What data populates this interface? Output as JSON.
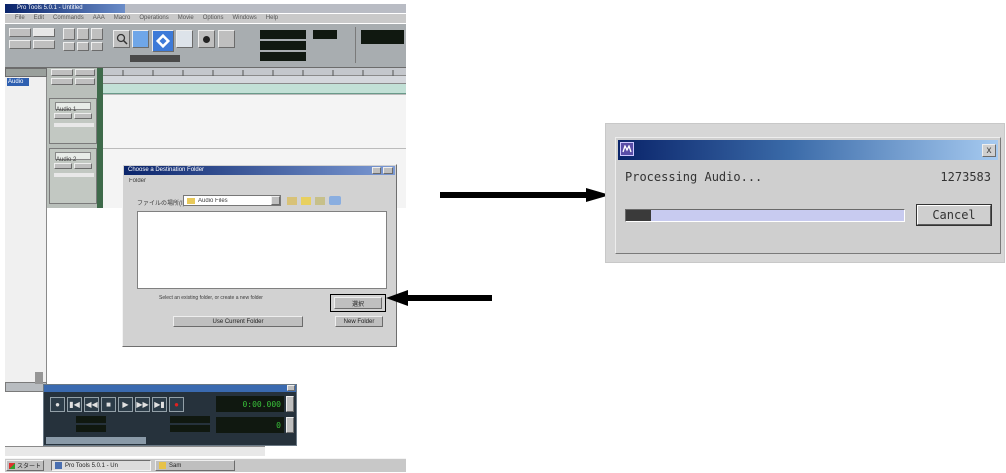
{
  "left_screenshot": {
    "app_title": "Pro Tools 5.0.1 - Untitled",
    "menu": [
      "File",
      "Edit",
      "Commands",
      "AAA",
      "Macro",
      "Operations",
      "Movie",
      "Options",
      "Windows",
      "Help"
    ],
    "track_list_label": "Audio",
    "tracks": [
      {
        "name": "Audio 1",
        "buttons": [
          "rec",
          "mute"
        ]
      },
      {
        "name": "Audio 2",
        "buttons": [
          "rec",
          "mute"
        ]
      }
    ],
    "dialog": {
      "title": "Choose a Destination Folder",
      "subtitle": "Folder",
      "location_label": "ファイルの場所(I):",
      "location_value": "Audio Files",
      "hint_text": "Select an existing folder, or create a new folder",
      "select_label": "選択",
      "new_folder_label": "New Folder",
      "current_folder_label": "Use Current Folder"
    },
    "transport": {
      "main_counter": "0:00.000",
      "sub_counter": "0",
      "buttons": [
        "online-icon",
        "return-to-zero-icon",
        "rewind-icon",
        "stop-icon",
        "play-icon",
        "fast-forward-icon",
        "go-to-end-icon",
        "record-icon"
      ]
    },
    "taskbar": {
      "start_label": "スタート",
      "task_label": "Pro Tools 5.0.1 - Un",
      "task2_label": "Sam"
    }
  },
  "progress_dialog": {
    "app_icon": "pro-tools-icon",
    "close_glyph": "x",
    "message": "Processing Audio...",
    "sample_count": "1273583",
    "progress_fraction": 0.09,
    "cancel_label": "Cancel"
  },
  "colors": {
    "title_bar_start": "#0a246a",
    "title_bar_end": "#a6caf0",
    "progress_fill": "#3a3a3a",
    "progress_track": "#c8cbf0",
    "lcd_green": "#39c13a",
    "arrow": "#000000"
  }
}
